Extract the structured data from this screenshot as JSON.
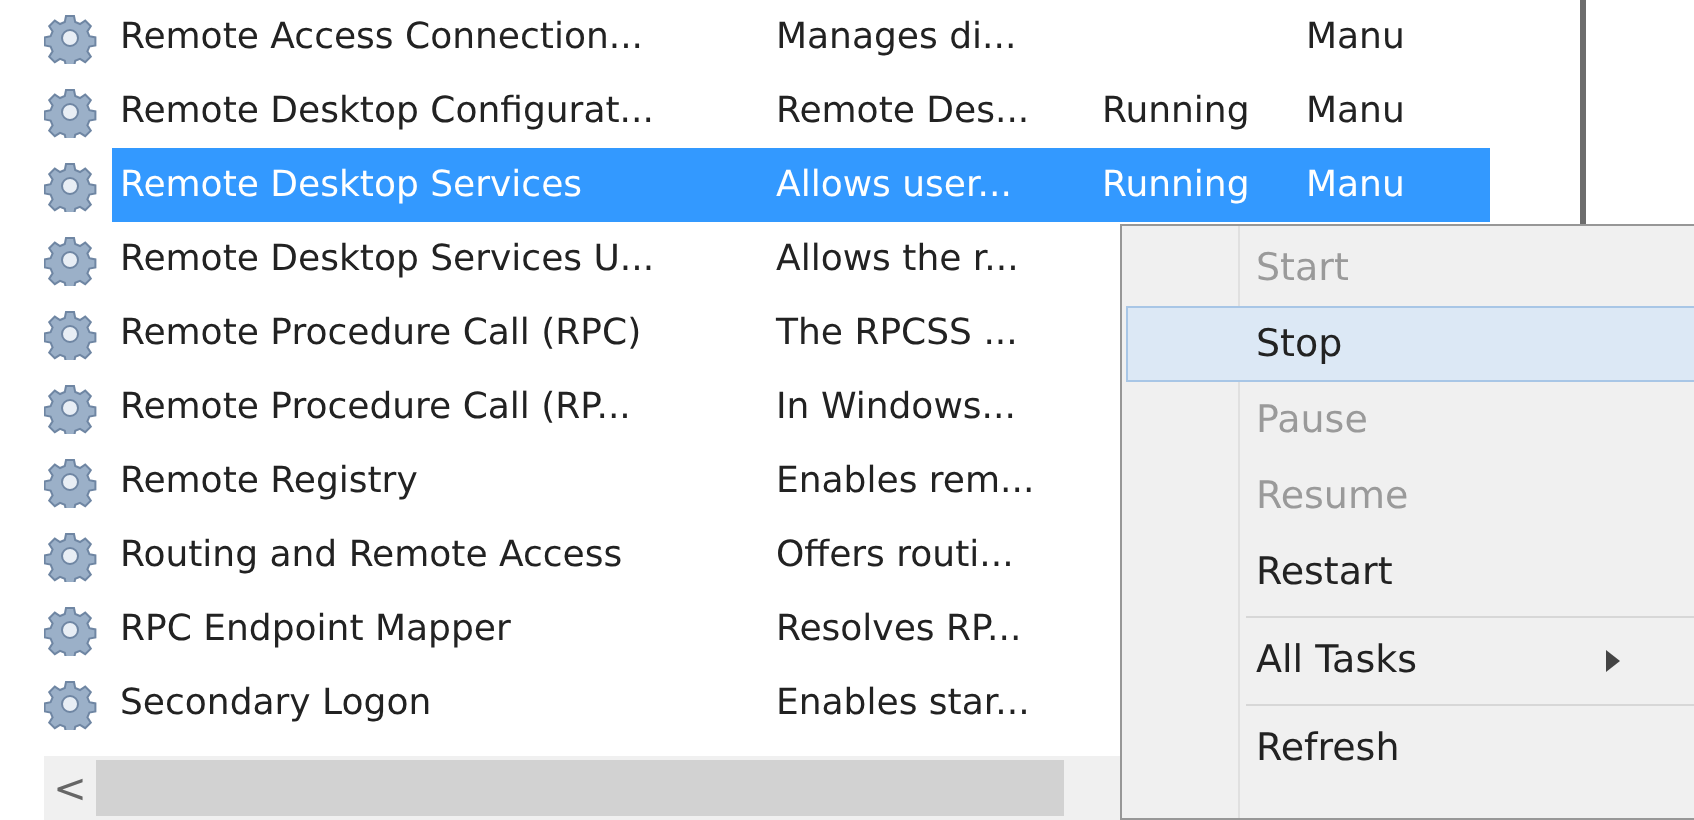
{
  "services": {
    "rows": [
      {
        "name": "Remote Access Connection...",
        "description": "Manages di...",
        "status": "",
        "startup_type": "Manu",
        "selected": false
      },
      {
        "name": "Remote Desktop Configurat...",
        "description": "Remote Des...",
        "status": "Running",
        "startup_type": "Manu",
        "selected": false
      },
      {
        "name": "Remote Desktop Services",
        "description": "Allows user...",
        "status": "Running",
        "startup_type": "Manu",
        "selected": true
      },
      {
        "name": "Remote Desktop Services U...",
        "description": "Allows the r...",
        "status": "",
        "startup_type": "",
        "selected": false
      },
      {
        "name": "Remote Procedure Call (RPC)",
        "description": "The RPCSS ...",
        "status": "",
        "startup_type": "",
        "selected": false
      },
      {
        "name": "Remote Procedure Call (RP...",
        "description": "In Windows...",
        "status": "",
        "startup_type": "",
        "selected": false
      },
      {
        "name": "Remote Registry",
        "description": "Enables rem...",
        "status": "",
        "startup_type": "",
        "selected": false
      },
      {
        "name": "Routing and Remote Access",
        "description": "Offers routi...",
        "status": "",
        "startup_type": "",
        "selected": false
      },
      {
        "name": "RPC Endpoint Mapper",
        "description": "Resolves RP...",
        "status": "",
        "startup_type": "",
        "selected": false
      },
      {
        "name": "Secondary Logon",
        "description": "Enables star...",
        "status": "",
        "startup_type": "",
        "selected": false
      }
    ],
    "scroll_left": "<"
  },
  "context_menu": {
    "items": [
      {
        "kind": "item",
        "label": "Start",
        "disabled": true,
        "selected": false
      },
      {
        "kind": "item",
        "label": "Stop",
        "disabled": false,
        "selected": true
      },
      {
        "kind": "item",
        "label": "Pause",
        "disabled": true,
        "selected": false
      },
      {
        "kind": "item",
        "label": "Resume",
        "disabled": true,
        "selected": false
      },
      {
        "kind": "item",
        "label": "Restart",
        "disabled": false,
        "selected": false
      },
      {
        "kind": "separator"
      },
      {
        "kind": "submenu",
        "label": "All Tasks",
        "disabled": false,
        "selected": false
      },
      {
        "kind": "separator"
      },
      {
        "kind": "item",
        "label": "Refresh",
        "disabled": false,
        "selected": false
      }
    ]
  }
}
